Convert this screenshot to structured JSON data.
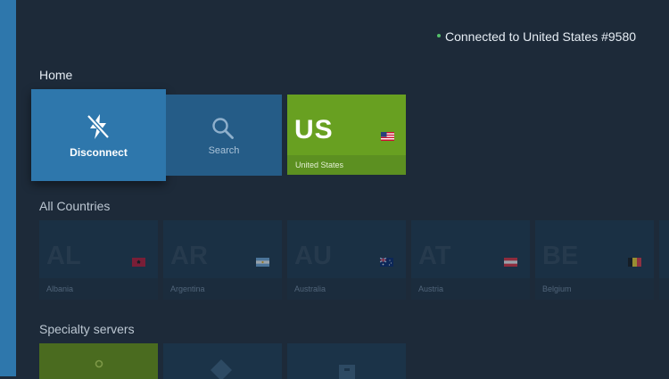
{
  "status": {
    "text": "Connected to United States #9580",
    "dot_color": "#54c06a"
  },
  "sections": {
    "home": "Home",
    "all_countries": "All Countries",
    "specialty": "Specialty servers"
  },
  "home_tiles": {
    "disconnect": {
      "label": "Disconnect",
      "icon": "lightning-off-icon"
    },
    "search": {
      "label": "Search",
      "icon": "search-icon"
    },
    "current": {
      "code": "US",
      "name": "United States",
      "icon": "us-flag-icon"
    }
  },
  "countries": [
    {
      "code": "AL",
      "name": "Albania",
      "flag": "albania-flag-icon"
    },
    {
      "code": "AR",
      "name": "Argentina",
      "flag": "argentina-flag-icon"
    },
    {
      "code": "AU",
      "name": "Australia",
      "flag": "australia-flag-icon"
    },
    {
      "code": "AT",
      "name": "Austria",
      "flag": "austria-flag-icon"
    },
    {
      "code": "BE",
      "name": "Belgium",
      "flag": "belgium-flag-icon"
    }
  ],
  "colors": {
    "background": "#1d2a39",
    "accent_blue": "#2e77ac",
    "search_tile": "#255c87",
    "connected_green": "#68a021"
  }
}
